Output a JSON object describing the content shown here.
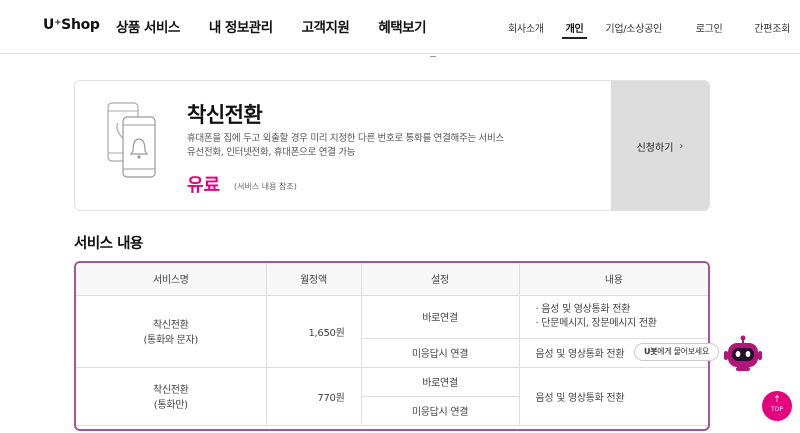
{
  "header": {
    "logo": "U⁺Shop",
    "gnb": [
      "상품 서비스",
      "내 정보관리",
      "고객지원",
      "혜택보기"
    ],
    "sub_nav": [
      "회사소개",
      "개인",
      "기업/소상공인"
    ],
    "active_sub_nav": "개인",
    "util": [
      "로그인",
      "간편조회"
    ]
  },
  "card": {
    "title": "착신전환",
    "desc_line1": "휴대폰을 집에 두고 외출할 경우 미리 지정한 다른 번호로 통화를 연결해주는 서비스",
    "desc_line2": "유선전화, 인터넷전화, 휴대폰으로 연결 가능",
    "price": "유료",
    "price_note": "(서비스 내용 참조)",
    "apply_label": "신청하기",
    "apply_chevron": "›"
  },
  "section_title": "서비스 내용",
  "table": {
    "headers": [
      "서비스명",
      "월정액",
      "설정",
      "내용"
    ],
    "rows": [
      {
        "name_line1": "착신전환",
        "name_line2": "(통화와 문자)",
        "fee": "1,650원",
        "settings": [
          {
            "label": "바로연결",
            "content": [
              "음성 및 영상통화 전환",
              "단문메시지, 장문메시지 전환"
            ]
          },
          {
            "label": "미응답시 연결",
            "content": [
              "음성 및 영상통화 전환"
            ]
          }
        ]
      },
      {
        "name_line1": "착신전환",
        "name_line2": "(통화만)",
        "fee": "770원",
        "settings": [
          {
            "label": "바로연결"
          },
          {
            "label": "미응답시 연결"
          }
        ],
        "content": "음성 및 영상통화 전환"
      }
    ]
  },
  "chatbot": {
    "bubble_bold": "U봇",
    "bubble_rest": "에게 물어보세요",
    "icon": "robot-icon"
  },
  "top_button": {
    "arrow": "↑",
    "label": "TOP"
  },
  "colors": {
    "accent": "#e6007e",
    "table_border": "#a0579a",
    "apply_bg": "#dcdcdc",
    "robot": "#b0177a"
  }
}
